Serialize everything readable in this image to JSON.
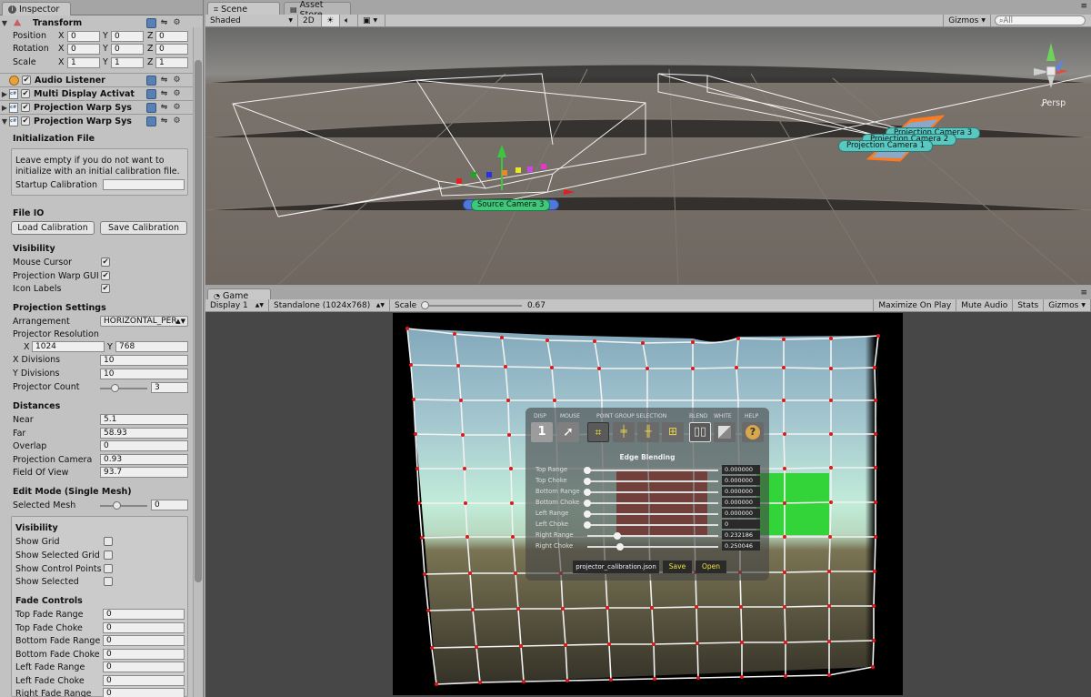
{
  "inspector": {
    "tab_label": "Inspector",
    "components": [
      {
        "name": "Transform",
        "expanded": true,
        "checkbox": false
      },
      {
        "name": "Audio Listener",
        "expanded": false,
        "checkbox": true
      },
      {
        "name": "Multi Display Activat",
        "expanded": false,
        "checkbox": true
      },
      {
        "name": "Projection Warp Sys",
        "expanded": false,
        "checkbox": true
      },
      {
        "name": "Projection Warp Sys",
        "expanded": true,
        "checkbox": true
      }
    ],
    "transform": {
      "rows": [
        {
          "label": "Position",
          "x": "0",
          "y": "0",
          "z": "0"
        },
        {
          "label": "Rotation",
          "x": "0",
          "y": "0",
          "z": "0"
        },
        {
          "label": "Scale",
          "x": "1",
          "y": "1",
          "z": "1"
        }
      ],
      "x_label": "X",
      "y_label": "Y",
      "z_label": "Z"
    },
    "init_file": {
      "title": "Initialization File",
      "help_line1": "Leave empty if you do not want to",
      "help_line2": "initialize with an initial calibration file.",
      "startup_label": "Startup Calibration",
      "startup_value": ""
    },
    "fileio": {
      "title": "File IO",
      "load_label": "Load Calibration",
      "save_label": "Save Calibration"
    },
    "visibility": {
      "title": "Visibility",
      "items": [
        {
          "label": "Mouse Cursor",
          "checked": true
        },
        {
          "label": "Projection Warp GUI",
          "checked": true
        },
        {
          "label": "Icon Labels",
          "checked": true
        }
      ]
    },
    "projection": {
      "title": "Projection Settings",
      "arrangement_label": "Arrangement",
      "arrangement_value": "HORIZONTAL_PER",
      "resolution_label": "Projector Resolution",
      "res_x_label": "X",
      "res_x": "1024",
      "res_y_label": "Y",
      "res_y": "768",
      "xdiv_label": "X Divisions",
      "xdiv": "10",
      "ydiv_label": "Y Divisions",
      "ydiv": "10",
      "count_label": "Projector Count",
      "count": "3",
      "count_fraction": 0.4
    },
    "distances": {
      "title": "Distances",
      "near_label": "Near",
      "near": "5.1",
      "far_label": "Far",
      "far": "58.93",
      "overlap_label": "Overlap",
      "overlap": "0",
      "camera_label": "Projection Camera",
      "camera": "0.93",
      "fov_label": "Field Of View",
      "fov": "93.7"
    },
    "edit_mode": {
      "title": "Edit Mode (Single Mesh)",
      "selected_label": "Selected Mesh",
      "selected": "0",
      "selected_fraction": 0.0
    },
    "visibility2": {
      "title": "Visibility",
      "items": [
        {
          "label": "Show Grid",
          "checked": false
        },
        {
          "label": "Show Selected Grid",
          "checked": false
        },
        {
          "label": "Show Control Points",
          "checked": false
        },
        {
          "label": "Show Selected",
          "checked": false
        }
      ]
    },
    "fade": {
      "title": "Fade Controls",
      "items": [
        {
          "label": "Top Fade Range",
          "value": "0"
        },
        {
          "label": "Top Fade Choke",
          "value": "0"
        },
        {
          "label": "Bottom Fade Range",
          "value": "0"
        },
        {
          "label": "Bottom Fade Choke",
          "value": "0"
        },
        {
          "label": "Left Fade Range",
          "value": "0"
        },
        {
          "label": "Left Fade Choke",
          "value": "0"
        },
        {
          "label": "Right Fade Range",
          "value": "0"
        }
      ]
    }
  },
  "scene": {
    "tabs": [
      {
        "label": "Scene"
      },
      {
        "label": "Asset Store"
      }
    ],
    "toolbar": {
      "shading": "Shaded",
      "mode2d": "2D",
      "gizmos": "Gizmos",
      "search_placeholder": "All"
    },
    "persp_label": "Persp",
    "labels": [
      {
        "text": "Projection Camera 3"
      },
      {
        "text": "Projection Camera 2"
      },
      {
        "text": "Projection Camera 1"
      },
      {
        "text": "Source Camera 3"
      }
    ]
  },
  "game": {
    "tab_label": "Game",
    "toolbar": {
      "display": "Display 1",
      "resolution": "Standalone (1024x768)",
      "scale_label": "Scale",
      "scale_value": "0.67",
      "maximize": "Maximize On Play",
      "mute": "Mute Audio",
      "stats": "Stats",
      "gizmos": "Gizmos"
    },
    "overlay": {
      "headers": {
        "disp": "DISP",
        "mouse": "MOUSE",
        "point_group": "POINT GROUP SELECTION",
        "blend": "BLEND",
        "white": "WHITE",
        "help": "HELP"
      },
      "disp_value": "1",
      "help_icon": "?",
      "edge_title": "Edge Blending",
      "sliders": [
        {
          "label": "Top Range",
          "value": "0.000000",
          "fraction": 0.0
        },
        {
          "label": "Top Choke",
          "value": "0.000000",
          "fraction": 0.0
        },
        {
          "label": "Bottom Range",
          "value": "0.000000",
          "fraction": 0.0
        },
        {
          "label": "Bottom Choke",
          "value": "0.000000",
          "fraction": 0.0
        },
        {
          "label": "Left Range",
          "value": "0.000000",
          "fraction": 0.0
        },
        {
          "label": "Left Choke",
          "value": "0",
          "fraction": 0.0
        },
        {
          "label": "Right Range",
          "value": "0.232186",
          "fraction": 0.232
        },
        {
          "label": "Right Choke",
          "value": "0.250046",
          "fraction": 0.25
        }
      ],
      "filename": "projector_calibration.json",
      "save_label": "Save",
      "open_label": "Open"
    }
  },
  "colors": {
    "accent": "#5a7fb2",
    "label_green": "#3ec97a",
    "label_teal": "#58c8c0",
    "overlay_yellow": "#f2e23a",
    "grid_point": "#e01818"
  }
}
